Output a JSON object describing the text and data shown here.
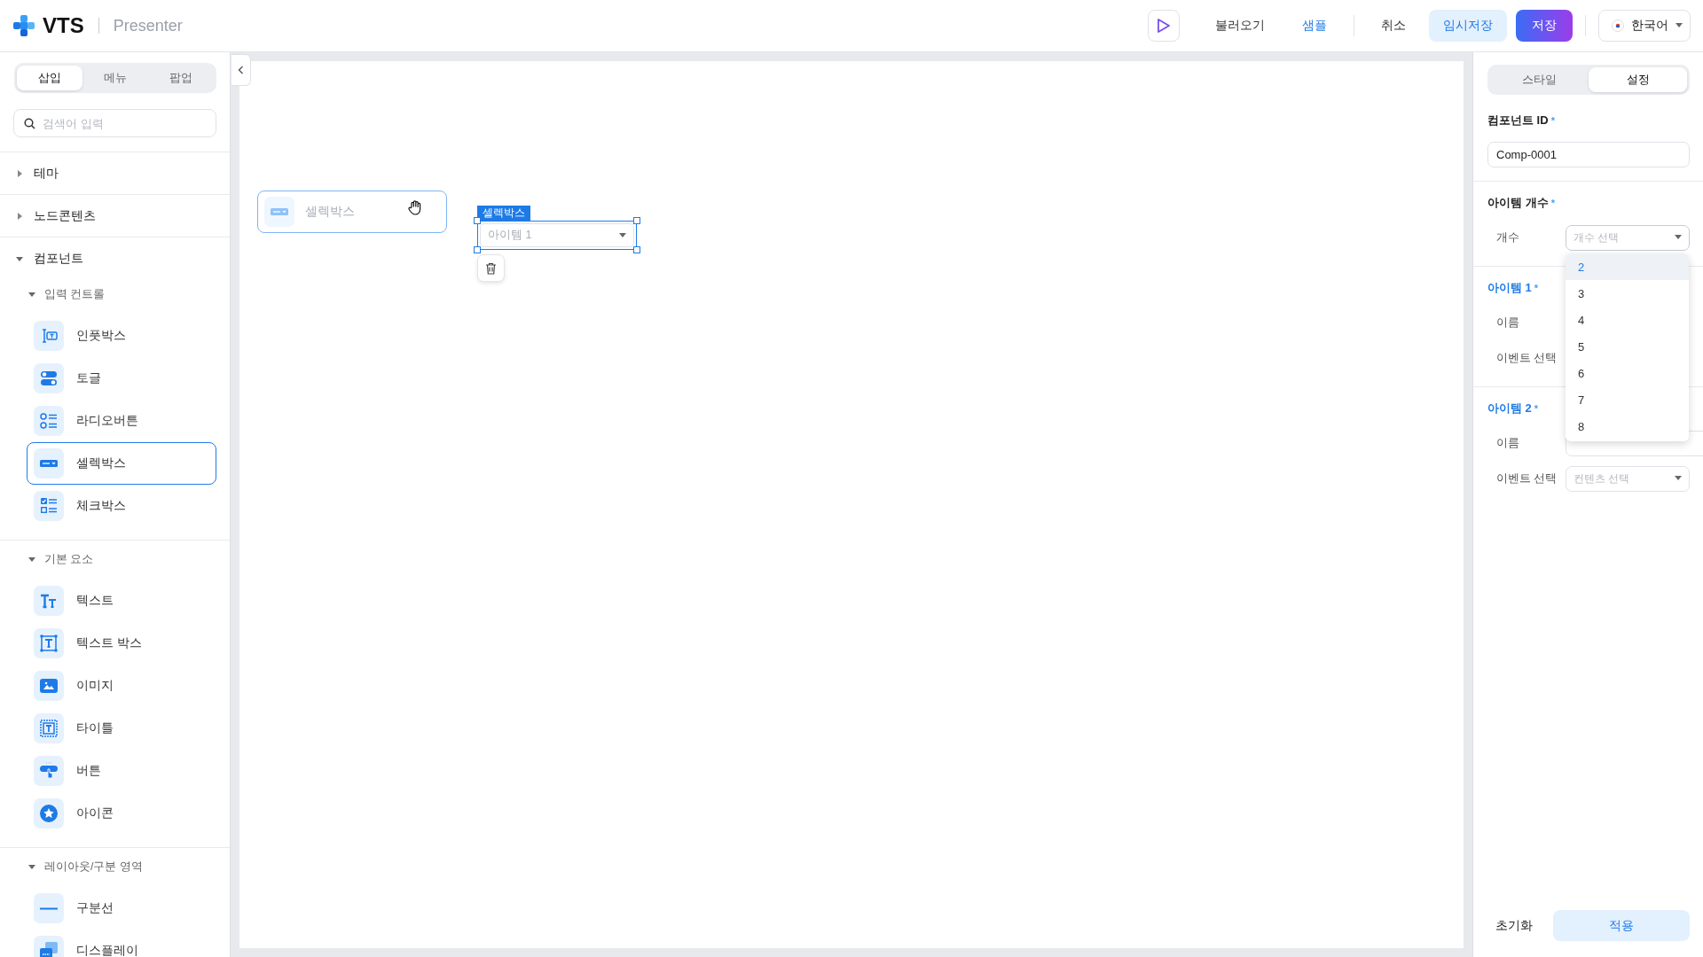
{
  "header": {
    "logo": "VTS",
    "product": "Presenter",
    "action_groups": [
      [
        {
          "kind": "play"
        },
        {
          "kind": "plain",
          "label": "불러오기"
        },
        {
          "kind": "link",
          "label": "샘플"
        }
      ],
      [
        {
          "kind": "plain",
          "label": "취소"
        },
        {
          "kind": "secondary",
          "label": "임시저장"
        },
        {
          "kind": "primary",
          "label": "저장"
        }
      ]
    ],
    "language": "한국어"
  },
  "sidebar": {
    "tabs": [
      {
        "label": "삽입",
        "selected": true
      },
      {
        "label": "메뉴",
        "selected": false
      },
      {
        "label": "팝업",
        "selected": false
      }
    ],
    "search": {
      "placeholder": "검색어 입력"
    },
    "sections": [
      {
        "label": "테마",
        "expanded": false
      },
      {
        "label": "노드콘텐츠",
        "expanded": false
      },
      {
        "label": "컴포넌트",
        "expanded": true,
        "children": [
          {
            "label": "입력 컨트롤",
            "expanded": true,
            "children": [
              {
                "label": "인풋박스",
                "kind": "input",
                "selected": false
              },
              {
                "label": "토글",
                "kind": "toggle",
                "selected": false
              },
              {
                "label": "라디오버튼",
                "kind": "radio",
                "selected": false
              },
              {
                "label": "셀렉박스",
                "kind": "select",
                "selected": true
              },
              {
                "label": "체크박스",
                "kind": "checkbox",
                "selected": false
              }
            ]
          },
          {
            "label": "기본 요소",
            "expanded": true,
            "children": [
              {
                "label": "텍스트",
                "kind": "text",
                "selected": false
              },
              {
                "label": "텍스트 박스",
                "kind": "textbox",
                "selected": false
              },
              {
                "label": "이미지",
                "kind": "image",
                "selected": false
              },
              {
                "label": "타이틀",
                "kind": "title",
                "selected": false
              },
              {
                "label": "버튼",
                "kind": "button",
                "selected": false
              },
              {
                "label": "아이콘",
                "kind": "star",
                "selected": false
              }
            ]
          },
          {
            "label": "레이아웃/구분 영역",
            "expanded": true,
            "children": [
              {
                "label": "구분선",
                "kind": "divider",
                "selected": false
              },
              {
                "label": "디스플레이",
                "kind": "display",
                "selected": false
              }
            ]
          }
        ]
      }
    ]
  },
  "canvas": {
    "dragging": {
      "label": "셀렉박스"
    },
    "selected_component": {
      "tag": "셀렉박스",
      "value": "아이템 1"
    }
  },
  "panel": {
    "tabs": [
      {
        "label": "스타일",
        "selected": false
      },
      {
        "label": "설정",
        "selected": true
      }
    ],
    "component_id": {
      "label": "컴포넌트 ID",
      "required_mark": "*",
      "value": "Comp-0001"
    },
    "item_count": {
      "label": "아이템 개수",
      "required_mark": "*",
      "field_label": "개수",
      "placeholder": "개수 선택",
      "open": true,
      "options": [
        {
          "label": "2",
          "selected": true
        },
        {
          "label": "3",
          "selected": false
        },
        {
          "label": "4",
          "selected": false
        },
        {
          "label": "5",
          "selected": false
        },
        {
          "label": "6",
          "selected": false
        },
        {
          "label": "7",
          "selected": false
        },
        {
          "label": "8",
          "selected": false
        }
      ]
    },
    "items": [
      {
        "title": "아이템 1",
        "required_mark": "*",
        "fields": [
          {
            "label": "이름"
          },
          {
            "label": "이벤트 선택"
          }
        ]
      },
      {
        "title": "아이템 2",
        "required_mark": "*",
        "fields": [
          {
            "label": "이름",
            "kind": "text"
          },
          {
            "label": "이벤트 선택",
            "kind": "select",
            "placeholder": "컨텐츠 선택"
          }
        ]
      }
    ],
    "footer": {
      "reset": "초기화",
      "apply": "적용"
    }
  }
}
